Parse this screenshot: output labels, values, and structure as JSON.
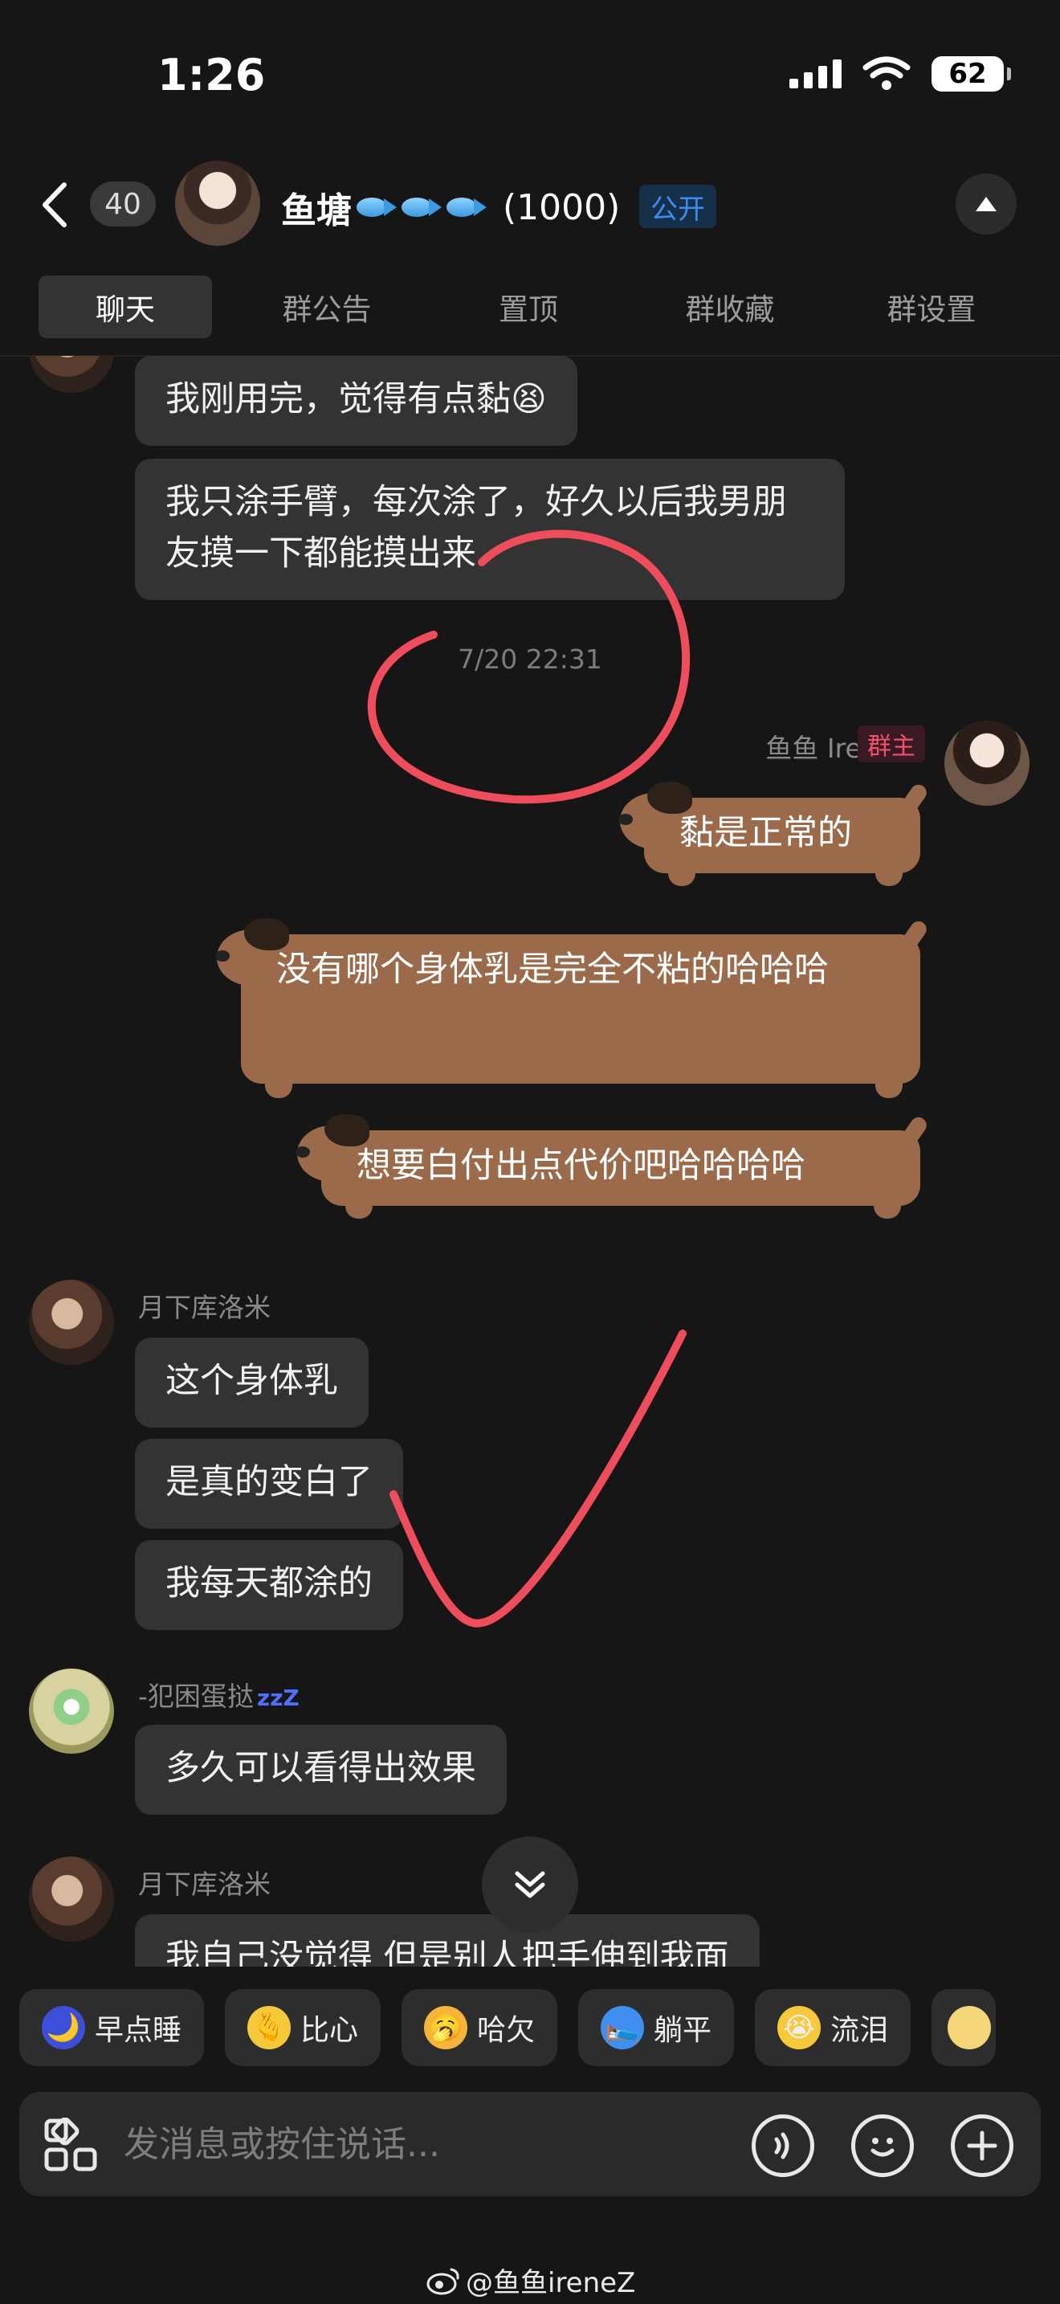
{
  "status_bar": {
    "time": "1:26",
    "battery": "62"
  },
  "header": {
    "unread_count": "40",
    "group_name": "鱼塘",
    "member_count": "(1000)",
    "visibility": "公开"
  },
  "tabs": [
    {
      "label": "聊天"
    },
    {
      "label": "群公告"
    },
    {
      "label": "置顶"
    },
    {
      "label": "群收藏"
    },
    {
      "label": "群设置"
    }
  ],
  "messages": {
    "m1": "我刚用完，觉得有点黏😫",
    "m2": "我只涂手臂，每次涂了，好久以后我男朋友摸一下都能摸出来",
    "timestamp": "7/20 22:31",
    "owner_name": "鱼鱼 Irene",
    "owner_badge": "群主",
    "o1": "黏是正常的",
    "o2": "没有哪个身体乳是完全不粘的哈哈哈",
    "o3": "想要白付出点代价吧哈哈哈哈",
    "user1_name": "月下库洛米",
    "u1": "这个身体乳",
    "u2": "是真的变白了",
    "u3": "我每天都涂的",
    "user2_name": "-犯困蛋挞",
    "user2_suffix": "zzZ",
    "u4": "多久可以看得出效果",
    "user3_name": "月下库洛米",
    "u5": "我自己没觉得 但是别人把手伸到我面"
  },
  "reactions": [
    {
      "label": "早点睡",
      "emoji": "🌙"
    },
    {
      "label": "比心",
      "emoji": "🫰"
    },
    {
      "label": "哈欠",
      "emoji": "🥱"
    },
    {
      "label": "躺平",
      "emoji": "🛌"
    },
    {
      "label": "流泪",
      "emoji": "😭"
    }
  ],
  "input": {
    "placeholder": "发消息或按住说话..."
  },
  "watermark": "@鱼鱼ireneZ",
  "colors": {
    "accent_blue": "#3d8cf0",
    "owner_red": "#f2506b",
    "ink_red": "#ef4d5c",
    "dog_brown": "#9a6a4b"
  }
}
